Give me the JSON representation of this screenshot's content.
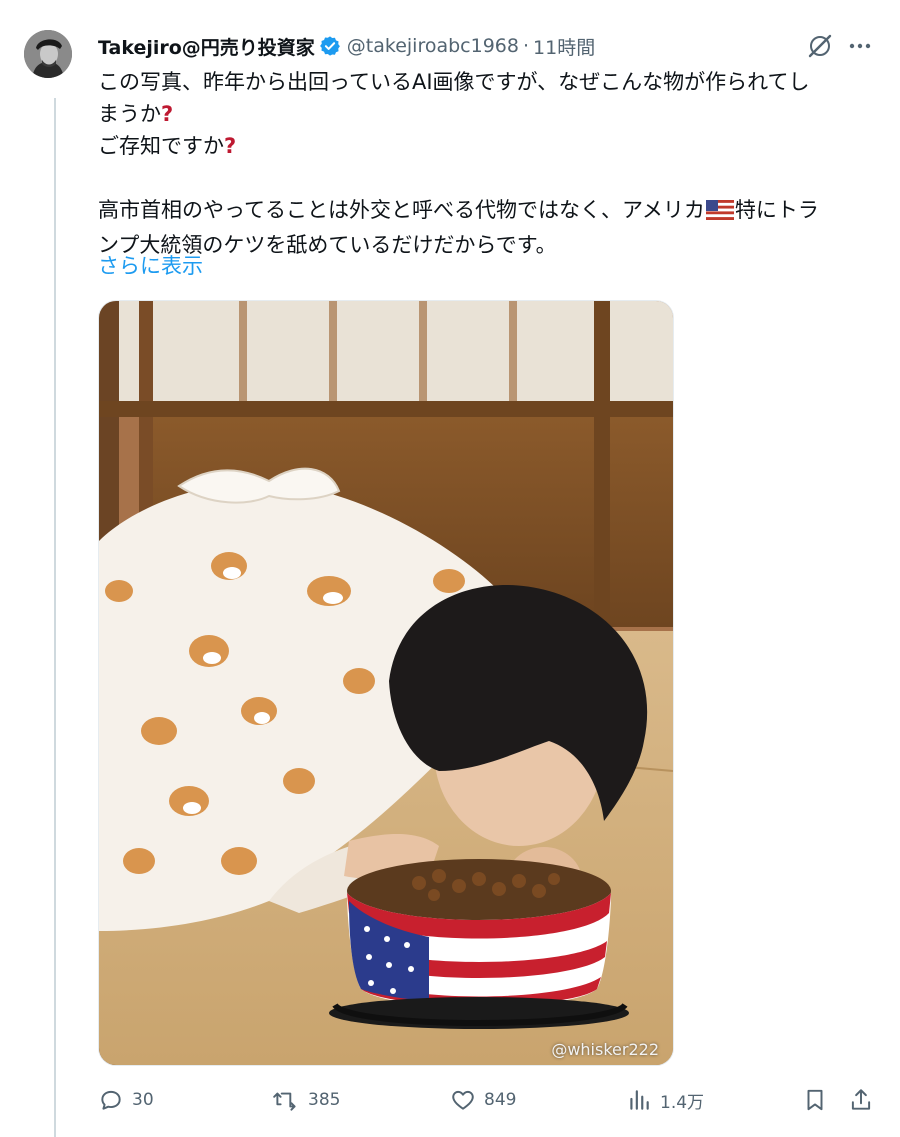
{
  "author": {
    "display_name": "Takejiro@円売り投資家",
    "handle": "@takejiroabc1968",
    "separator": "·",
    "time": "11時間"
  },
  "tweet": {
    "line1a": "この写真、昨年から出回っているAI画像ですが、なぜこんな物が作られてし",
    "line1b": "まうか",
    "line2": "ご存知ですか",
    "line3a": "高市首相のやってることは外交と呼べる代物ではなく、アメリカ",
    "line3b": "特にトラ",
    "line4": "ンプ大統領のケツを舐めているだけだからです。",
    "show_more": "さらに表示"
  },
  "media": {
    "watermark": "@whisker222"
  },
  "actions": {
    "replies": "30",
    "reposts": "385",
    "likes": "849",
    "views": "1.4万"
  },
  "colors": {
    "accent": "#1d9bf0",
    "secondary_text": "#536471",
    "question_mark": "#be1931"
  }
}
